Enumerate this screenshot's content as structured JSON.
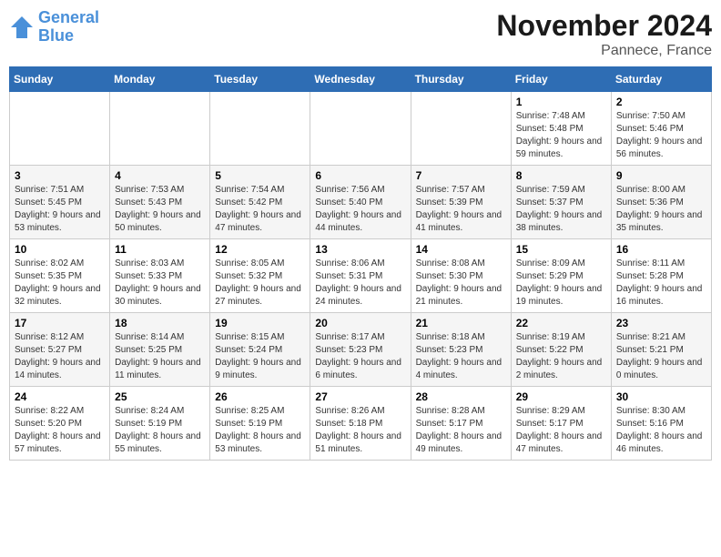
{
  "header": {
    "logo_line1": "General",
    "logo_line2": "Blue",
    "month": "November 2024",
    "location": "Pannece, France"
  },
  "weekdays": [
    "Sunday",
    "Monday",
    "Tuesday",
    "Wednesday",
    "Thursday",
    "Friday",
    "Saturday"
  ],
  "weeks": [
    [
      {
        "day": "",
        "info": ""
      },
      {
        "day": "",
        "info": ""
      },
      {
        "day": "",
        "info": ""
      },
      {
        "day": "",
        "info": ""
      },
      {
        "day": "",
        "info": ""
      },
      {
        "day": "1",
        "info": "Sunrise: 7:48 AM\nSunset: 5:48 PM\nDaylight: 9 hours and 59 minutes."
      },
      {
        "day": "2",
        "info": "Sunrise: 7:50 AM\nSunset: 5:46 PM\nDaylight: 9 hours and 56 minutes."
      }
    ],
    [
      {
        "day": "3",
        "info": "Sunrise: 7:51 AM\nSunset: 5:45 PM\nDaylight: 9 hours and 53 minutes."
      },
      {
        "day": "4",
        "info": "Sunrise: 7:53 AM\nSunset: 5:43 PM\nDaylight: 9 hours and 50 minutes."
      },
      {
        "day": "5",
        "info": "Sunrise: 7:54 AM\nSunset: 5:42 PM\nDaylight: 9 hours and 47 minutes."
      },
      {
        "day": "6",
        "info": "Sunrise: 7:56 AM\nSunset: 5:40 PM\nDaylight: 9 hours and 44 minutes."
      },
      {
        "day": "7",
        "info": "Sunrise: 7:57 AM\nSunset: 5:39 PM\nDaylight: 9 hours and 41 minutes."
      },
      {
        "day": "8",
        "info": "Sunrise: 7:59 AM\nSunset: 5:37 PM\nDaylight: 9 hours and 38 minutes."
      },
      {
        "day": "9",
        "info": "Sunrise: 8:00 AM\nSunset: 5:36 PM\nDaylight: 9 hours and 35 minutes."
      }
    ],
    [
      {
        "day": "10",
        "info": "Sunrise: 8:02 AM\nSunset: 5:35 PM\nDaylight: 9 hours and 32 minutes."
      },
      {
        "day": "11",
        "info": "Sunrise: 8:03 AM\nSunset: 5:33 PM\nDaylight: 9 hours and 30 minutes."
      },
      {
        "day": "12",
        "info": "Sunrise: 8:05 AM\nSunset: 5:32 PM\nDaylight: 9 hours and 27 minutes."
      },
      {
        "day": "13",
        "info": "Sunrise: 8:06 AM\nSunset: 5:31 PM\nDaylight: 9 hours and 24 minutes."
      },
      {
        "day": "14",
        "info": "Sunrise: 8:08 AM\nSunset: 5:30 PM\nDaylight: 9 hours and 21 minutes."
      },
      {
        "day": "15",
        "info": "Sunrise: 8:09 AM\nSunset: 5:29 PM\nDaylight: 9 hours and 19 minutes."
      },
      {
        "day": "16",
        "info": "Sunrise: 8:11 AM\nSunset: 5:28 PM\nDaylight: 9 hours and 16 minutes."
      }
    ],
    [
      {
        "day": "17",
        "info": "Sunrise: 8:12 AM\nSunset: 5:27 PM\nDaylight: 9 hours and 14 minutes."
      },
      {
        "day": "18",
        "info": "Sunrise: 8:14 AM\nSunset: 5:25 PM\nDaylight: 9 hours and 11 minutes."
      },
      {
        "day": "19",
        "info": "Sunrise: 8:15 AM\nSunset: 5:24 PM\nDaylight: 9 hours and 9 minutes."
      },
      {
        "day": "20",
        "info": "Sunrise: 8:17 AM\nSunset: 5:23 PM\nDaylight: 9 hours and 6 minutes."
      },
      {
        "day": "21",
        "info": "Sunrise: 8:18 AM\nSunset: 5:23 PM\nDaylight: 9 hours and 4 minutes."
      },
      {
        "day": "22",
        "info": "Sunrise: 8:19 AM\nSunset: 5:22 PM\nDaylight: 9 hours and 2 minutes."
      },
      {
        "day": "23",
        "info": "Sunrise: 8:21 AM\nSunset: 5:21 PM\nDaylight: 9 hours and 0 minutes."
      }
    ],
    [
      {
        "day": "24",
        "info": "Sunrise: 8:22 AM\nSunset: 5:20 PM\nDaylight: 8 hours and 57 minutes."
      },
      {
        "day": "25",
        "info": "Sunrise: 8:24 AM\nSunset: 5:19 PM\nDaylight: 8 hours and 55 minutes."
      },
      {
        "day": "26",
        "info": "Sunrise: 8:25 AM\nSunset: 5:19 PM\nDaylight: 8 hours and 53 minutes."
      },
      {
        "day": "27",
        "info": "Sunrise: 8:26 AM\nSunset: 5:18 PM\nDaylight: 8 hours and 51 minutes."
      },
      {
        "day": "28",
        "info": "Sunrise: 8:28 AM\nSunset: 5:17 PM\nDaylight: 8 hours and 49 minutes."
      },
      {
        "day": "29",
        "info": "Sunrise: 8:29 AM\nSunset: 5:17 PM\nDaylight: 8 hours and 47 minutes."
      },
      {
        "day": "30",
        "info": "Sunrise: 8:30 AM\nSunset: 5:16 PM\nDaylight: 8 hours and 46 minutes."
      }
    ]
  ]
}
